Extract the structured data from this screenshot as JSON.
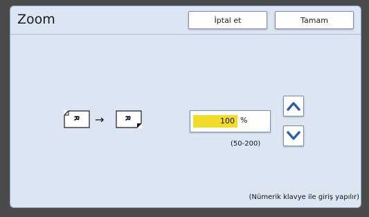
{
  "header": {
    "title": "Zoom",
    "cancel_label": "İptal et",
    "ok_label": "Tamam"
  },
  "zoom": {
    "value": "100",
    "unit": "%",
    "range_text": "(50-200)"
  },
  "illustration": {
    "paper_letter": "R",
    "arrow": "→"
  },
  "footer": {
    "hint": "(Nümerik klavye ile giriş yapılır)"
  },
  "colors": {
    "panel_bg": "#dce6f2",
    "accent_blue": "#2a5fa8",
    "input_highlight": "#f2dc2a"
  }
}
